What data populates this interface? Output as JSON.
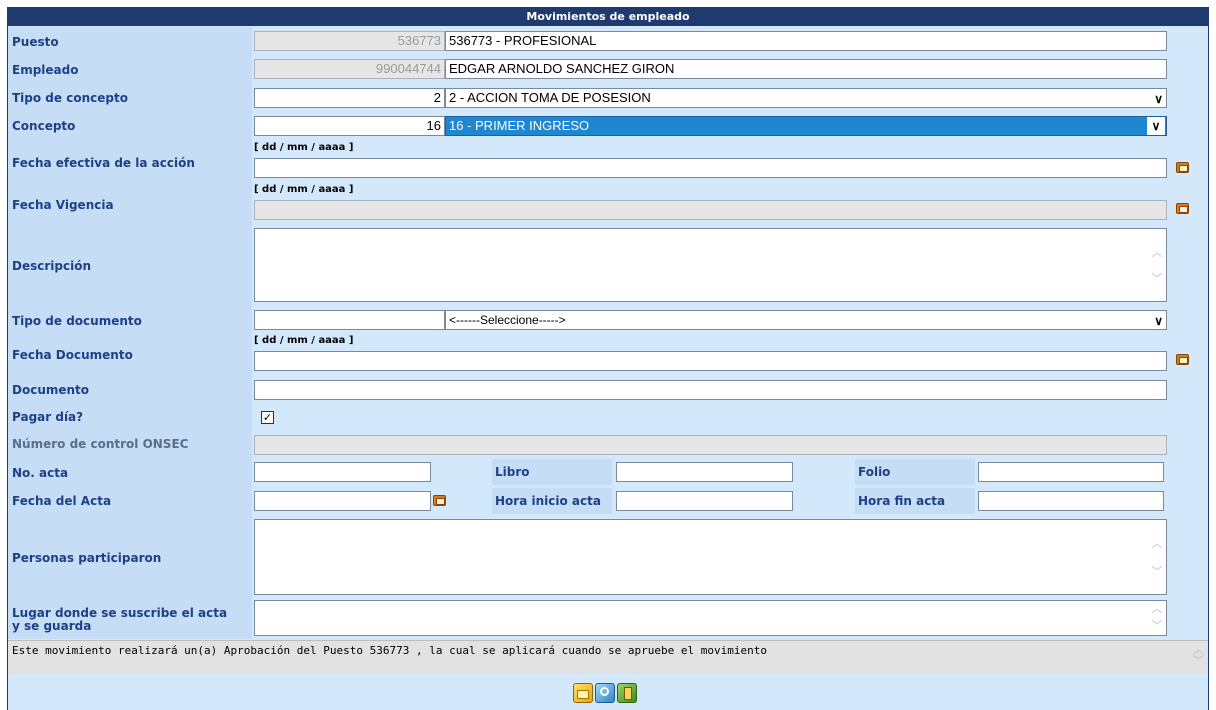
{
  "header": {
    "title": "Movimientos de empleado"
  },
  "puesto": {
    "label": "Puesto",
    "code": "536773",
    "value": "536773 - PROFESIONAL"
  },
  "empleado": {
    "label": "Empleado",
    "code": "990044744",
    "value": "EDGAR ARNOLDO  SANCHEZ GIRON"
  },
  "tipo_concepto": {
    "label": "Tipo de concepto",
    "code": "2",
    "value": "2 - ACCION TOMA DE POSESION"
  },
  "concepto": {
    "label": "Concepto",
    "code": "16",
    "value": "16 - PRIMER INGRESO"
  },
  "fecha_efectiva": {
    "label": "Fecha efectiva de la acción",
    "hint": "[ dd / mm / aaaa ]",
    "value": ""
  },
  "fecha_vigencia": {
    "label": "Fecha Vigencia",
    "hint": "[ dd / mm / aaaa ]",
    "value": ""
  },
  "descripcion": {
    "label": "Descripción",
    "value": ""
  },
  "tipo_documento": {
    "label": "Tipo de documento",
    "code": "",
    "value": "<------Seleccione----->"
  },
  "fecha_documento": {
    "label": "Fecha Documento",
    "hint": "[ dd / mm / aaaa ]",
    "value": ""
  },
  "documento": {
    "label": "Documento",
    "value": ""
  },
  "pagar_dia": {
    "label": "Pagar día?",
    "checked": true,
    "mark": "✓"
  },
  "numero_control": {
    "label": "Número de control ONSEC",
    "value": ""
  },
  "acta": {
    "no_acta_label": "No. acta",
    "libro_label": "Libro",
    "folio_label": "Folio",
    "fecha_label": "Fecha del Acta",
    "hora_inicio_label": "Hora inicio acta",
    "hora_fin_label": "Hora fin acta"
  },
  "personas": {
    "label": "Personas participaron",
    "value": ""
  },
  "lugar": {
    "label_line1": "Lugar donde se suscribe el acta",
    "label_line2": "y se guarda",
    "value": ""
  },
  "message": "Este movimiento realizará un(a) Aprobación del Puesto 536773 , la cual se aplicará cuando se apruebe el movimiento",
  "toolbar": {
    "buttons": [
      "new-icon",
      "search-icon",
      "exit-icon"
    ],
    "colors": {
      "new": "#f2c21c",
      "search": "#3aa0d8",
      "exit": "#5aa02c"
    }
  },
  "colors": {
    "header": "#1e3a6e",
    "background": "#d4e8fb",
    "label": "#1f3f87",
    "selected": "#1f86d2"
  }
}
